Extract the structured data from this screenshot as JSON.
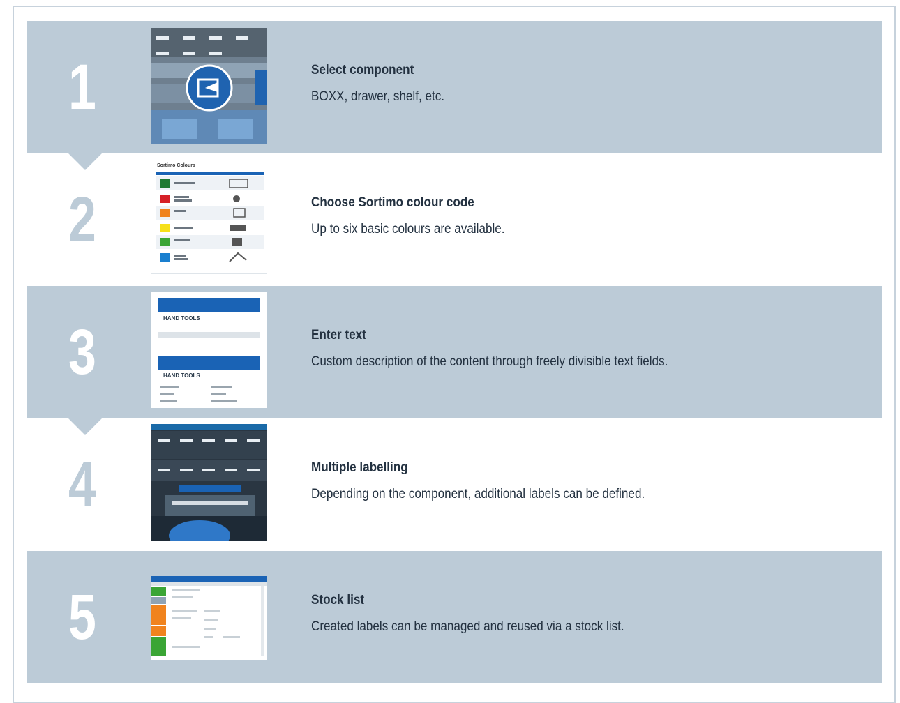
{
  "steps": [
    {
      "number": "1",
      "title": "Select component",
      "description": "BOXX, drawer, shelf, etc."
    },
    {
      "number": "2",
      "title": "Choose Sortimo colour code",
      "description": "Up to six basic colours are available."
    },
    {
      "number": "3",
      "title": "Enter text",
      "description": "Custom description of the content through freely divisible text fields."
    },
    {
      "number": "4",
      "title": "Multiple labelling",
      "description": "Depending on the component, additional labels can be defined."
    },
    {
      "number": "5",
      "title": "Stock list",
      "description": "Created labels can be managed and reused via a stock list."
    }
  ],
  "thumbnails": {
    "step2_heading": "Sortimo Colours",
    "step3_heading": "HAND TOOLS"
  },
  "colors": {
    "band": "#bccbd7",
    "text": "#233140",
    "sortimo_blue": "#1565c0",
    "palette": [
      "#c1272d",
      "#d62027",
      "#f0831e",
      "#f6e01a",
      "#3aa535",
      "#1a7fcf"
    ]
  }
}
